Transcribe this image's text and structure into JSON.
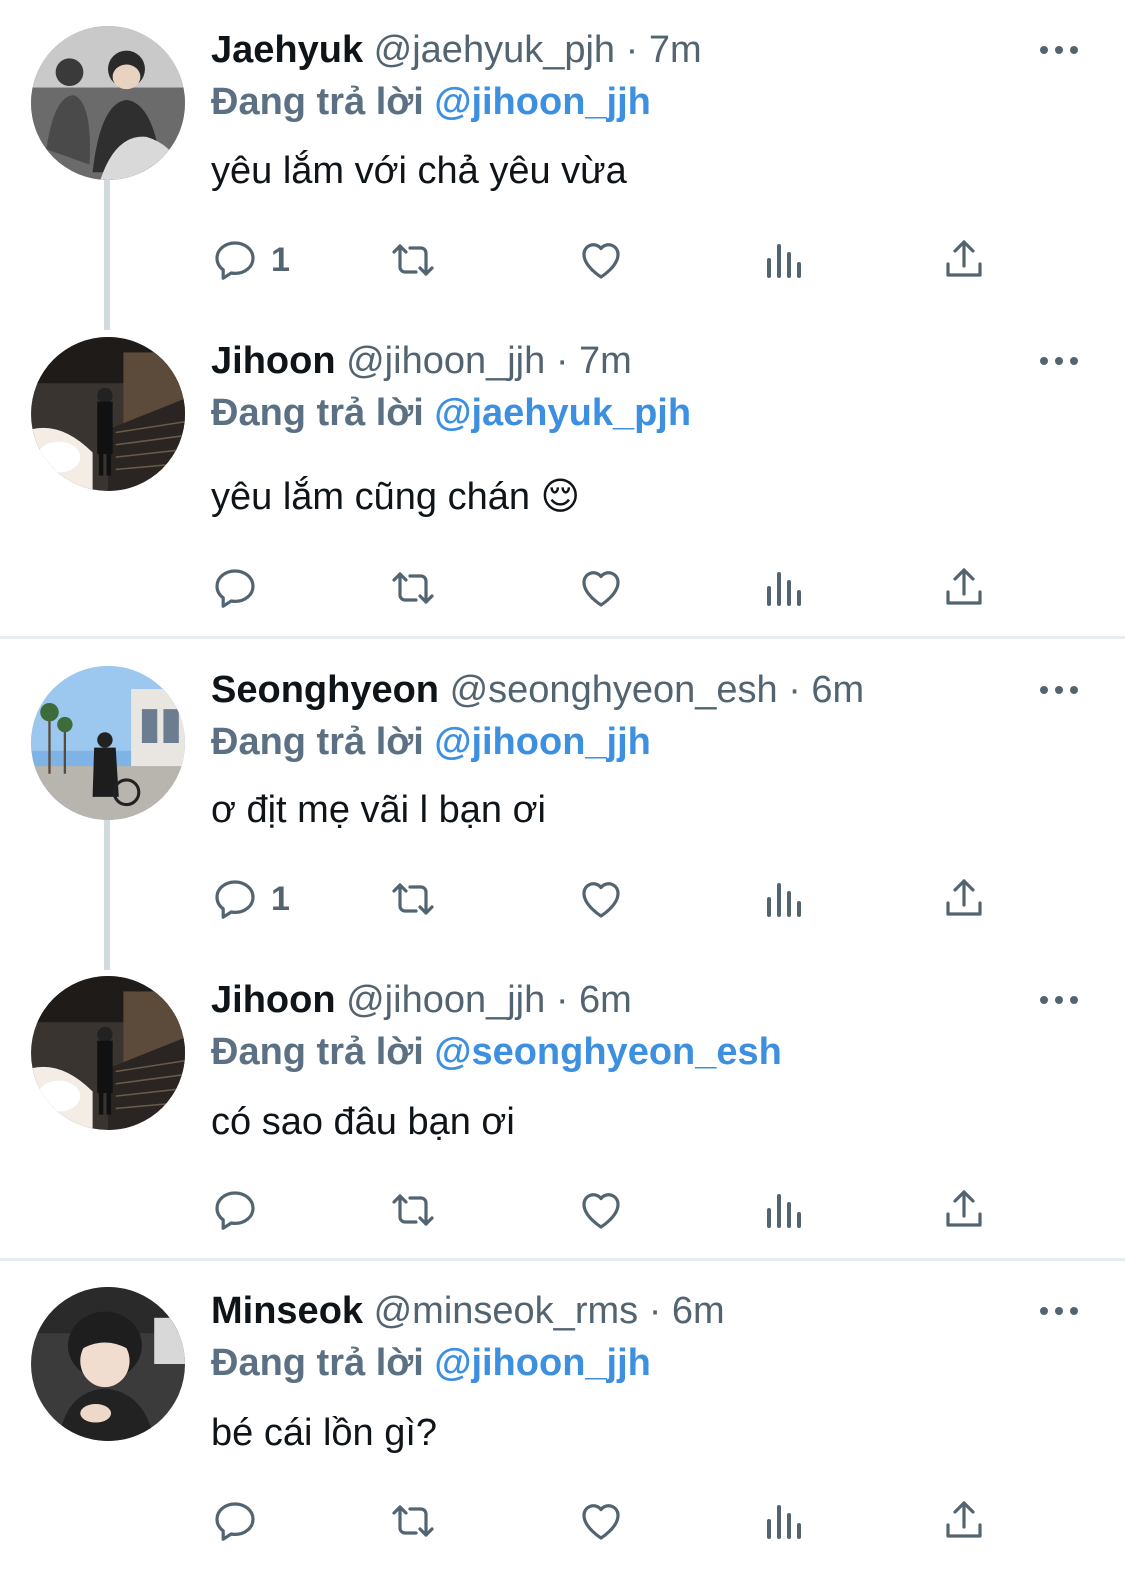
{
  "tweets": [
    {
      "name": "Jaehyuk",
      "handle": "@jaehyuk_pjh",
      "time": "7m",
      "replying_label": "Đang trả lời",
      "replying_to": "@jihoon_jjh",
      "text": "yêu lắm với chả yêu vừa",
      "reply_count": "1"
    },
    {
      "name": "Jihoon",
      "handle": "@jihoon_jjh",
      "time": "7m",
      "replying_label": "Đang trả lời",
      "replying_to": "@jaehyuk_pjh",
      "text": "yêu lắm cũng chán 😌",
      "reply_count": ""
    },
    {
      "name": "Seonghyeon",
      "handle": "@seonghyeon_esh",
      "time": "6m",
      "replying_label": "Đang trả lời",
      "replying_to": "@jihoon_jjh",
      "text": "ơ địt mẹ vãi l bạn ơi",
      "reply_count": "1"
    },
    {
      "name": "Jihoon",
      "handle": "@jihoon_jjh",
      "time": "6m",
      "replying_label": "Đang trả lời",
      "replying_to": "@seonghyeon_esh",
      "text": "có sao đâu bạn ơi",
      "reply_count": ""
    },
    {
      "name": "Minseok",
      "handle": "@minseok_rms",
      "time": "6m",
      "replying_label": "Đang trả lời",
      "replying_to": "@jihoon_jjh",
      "text": "bé cái lồn gì?",
      "reply_count": ""
    }
  ],
  "separator": "·",
  "icons": {
    "reply": "reply-icon",
    "retweet": "retweet-icon",
    "like": "heart-icon",
    "views": "analytics-icon",
    "share": "share-icon",
    "more": "more-icon"
  },
  "colors": {
    "link": "#3d8fe0",
    "secondary_text": "#536471",
    "thread_line": "#cfd9de",
    "divider": "#e6ecf0"
  }
}
